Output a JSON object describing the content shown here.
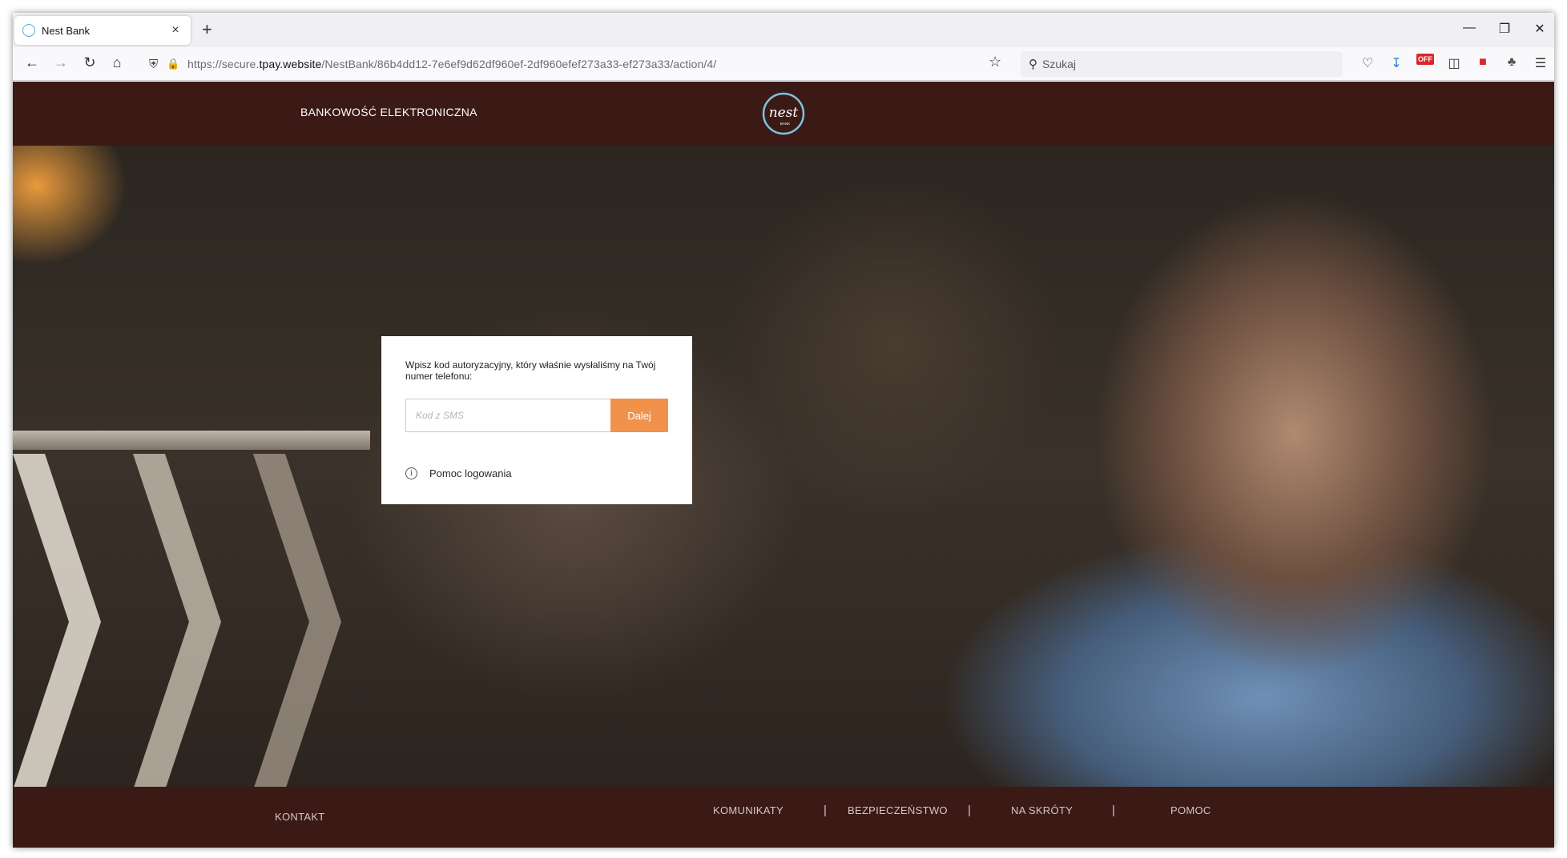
{
  "browser": {
    "tab_title": "Nest Bank",
    "tab_close": "×",
    "new_tab": "+",
    "url_prefix": "https://secure.",
    "url_domain": "tpay.website",
    "url_path": "/NestBank/86b4dd12-7e6ef9d62df960ef-2df960efef273a33-ef273a33/action/4/",
    "search_placeholder": "Szukaj",
    "addon_badge": "OFF"
  },
  "header": {
    "title": "BANKOWOŚĆ ELEKTRONICZNA",
    "logo_text": "nest",
    "logo_sub": "BANK"
  },
  "login": {
    "prompt": "Wpisz kod autoryzacyjny, który właśnie wysłaliśmy na Twój numer telefonu:",
    "sms_placeholder": "Kod z SMS",
    "sms_value": "",
    "submit_label": "Dalej",
    "help_label": "Pomoc logowania"
  },
  "footer": {
    "contact": "KONTAKT",
    "links": [
      "KOMUNIKATY",
      "BEZPIECZEŃSTWO",
      "NA SKRÓTY",
      "POMOC"
    ],
    "separator": "|"
  },
  "colors": {
    "brand_dark": "#3b1a16",
    "accent_orange": "#f0924a",
    "logo_ring": "#7cc3e3"
  }
}
